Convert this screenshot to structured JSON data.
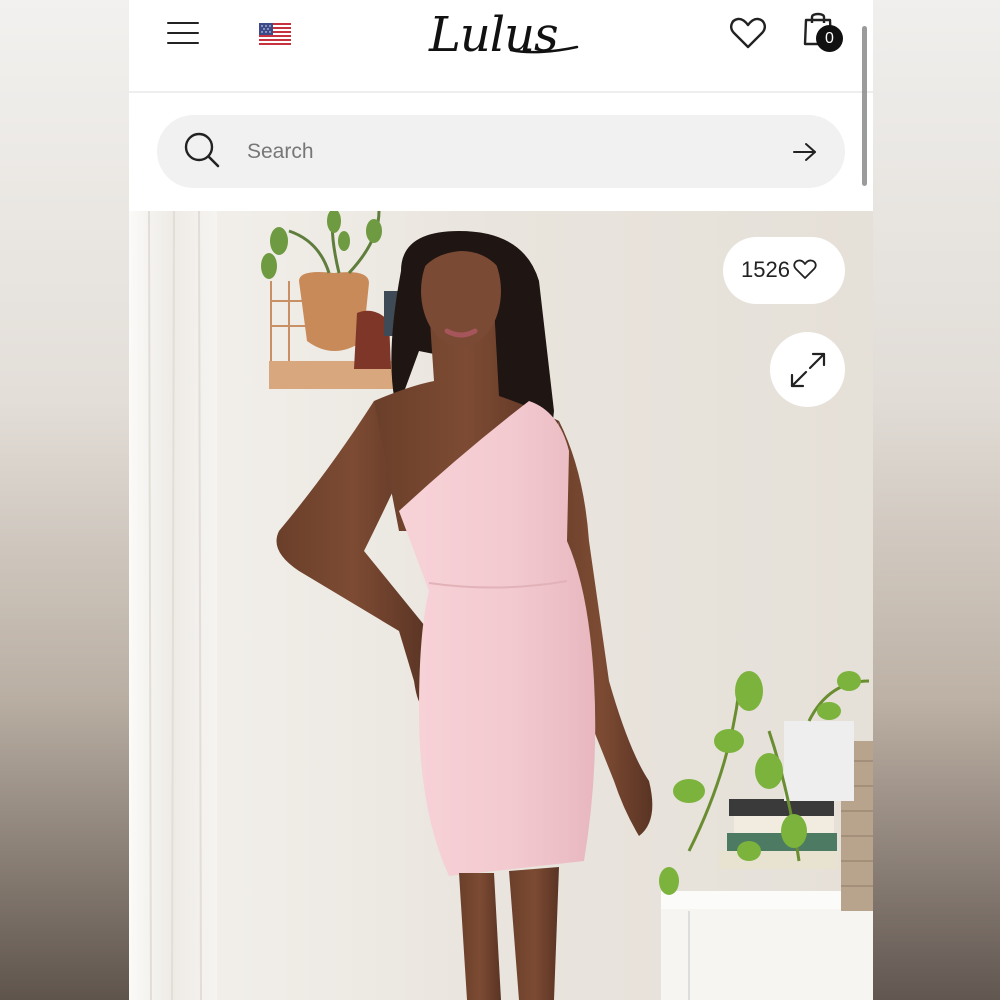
{
  "header": {
    "brand": "Lulus",
    "cart_count": "0",
    "icons": [
      "hamburger-menu-icon",
      "us-flag-icon",
      "heart-icon",
      "shopping-bag-icon"
    ]
  },
  "search": {
    "placeholder": "Search",
    "value": ""
  },
  "product": {
    "likes": "1526",
    "dress_color": "#f2c9cf",
    "icons": [
      "heart-outline-icon",
      "expand-icon"
    ]
  },
  "colors": {
    "text": "#111111",
    "search_bg": "#f1f1f1",
    "badge_bg": "#111111"
  }
}
